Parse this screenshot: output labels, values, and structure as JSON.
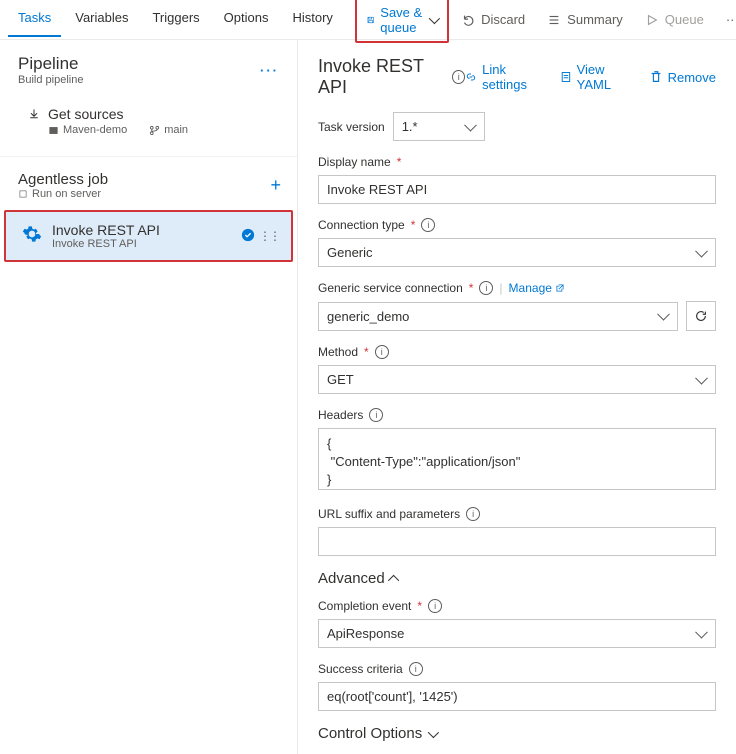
{
  "tabs": [
    "Tasks",
    "Variables",
    "Triggers",
    "Options",
    "History"
  ],
  "toolbar": {
    "saveQueue": "Save & queue",
    "discard": "Discard",
    "summary": "Summary",
    "queue": "Queue",
    "more": "···"
  },
  "pipeline": {
    "title": "Pipeline",
    "subtitle": "Build pipeline",
    "more": "···"
  },
  "getSources": {
    "title": "Get sources",
    "repo": "Maven-demo",
    "branch": "main"
  },
  "job": {
    "title": "Agentless job",
    "subtitle": "Run on server"
  },
  "task": {
    "title": "Invoke REST API",
    "subtitle": "Invoke REST API"
  },
  "pane": {
    "title": "Invoke REST API",
    "links": {
      "link": "Link settings",
      "yaml": "View YAML",
      "remove": "Remove"
    }
  },
  "fields": {
    "taskVersion": {
      "label": "Task version",
      "value": "1.*"
    },
    "displayName": {
      "label": "Display name",
      "value": "Invoke REST API"
    },
    "connectionType": {
      "label": "Connection type",
      "value": "Generic"
    },
    "serviceConn": {
      "label": "Generic service connection",
      "manage": "Manage",
      "value": "generic_demo"
    },
    "method": {
      "label": "Method",
      "value": "GET"
    },
    "headers": {
      "label": "Headers",
      "value": "{\n \"Content-Type\":\"application/json\"\n}"
    },
    "urlSuffix": {
      "label": "URL suffix and parameters",
      "value": ""
    },
    "advanced": "Advanced",
    "completionEvent": {
      "label": "Completion event",
      "value": "ApiResponse"
    },
    "successCriteria": {
      "label": "Success criteria",
      "value": "eq(root['count'], '1425')"
    },
    "controlOptions": "Control Options"
  }
}
